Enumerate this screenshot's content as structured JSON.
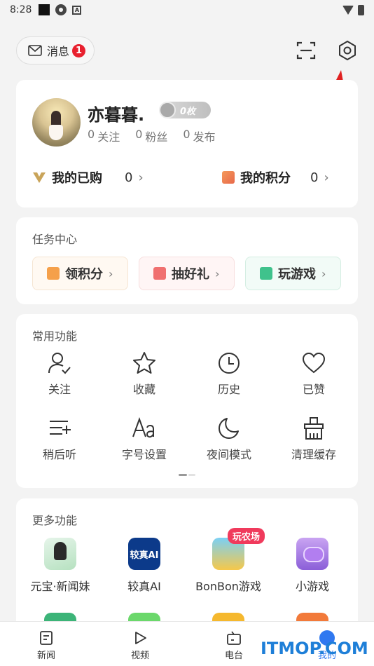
{
  "status_bar": {
    "time": "8:28",
    "a_icon_letter": "A"
  },
  "header": {
    "messages_label": "消息",
    "messages_count": "1"
  },
  "profile": {
    "username": "亦暮暮.",
    "medal_label": "0枚",
    "stats": [
      {
        "num": "0",
        "label": "关注"
      },
      {
        "num": "0",
        "label": "粉丝"
      },
      {
        "num": "0",
        "label": "发布"
      }
    ],
    "purchased_label": "我的已购",
    "purchased_value": "0",
    "points_label": "我的积分",
    "points_value": "0"
  },
  "tasks": {
    "title": "任务中心",
    "items": [
      {
        "label": "领积分"
      },
      {
        "label": "抽好礼"
      },
      {
        "label": "玩游戏"
      }
    ]
  },
  "common": {
    "title": "常用功能",
    "items": [
      {
        "label": "关注",
        "icon": "person-check-icon"
      },
      {
        "label": "收藏",
        "icon": "star-icon"
      },
      {
        "label": "历史",
        "icon": "clock-icon"
      },
      {
        "label": "已赞",
        "icon": "heart-icon"
      },
      {
        "label": "稍后听",
        "icon": "listen-later-icon"
      },
      {
        "label": "字号设置",
        "icon": "font-size-icon"
      },
      {
        "label": "夜间模式",
        "icon": "moon-icon"
      },
      {
        "label": "清理缓存",
        "icon": "broom-icon"
      }
    ]
  },
  "more": {
    "title": "更多功能",
    "apps": [
      {
        "label": "元宝·新闻妹"
      },
      {
        "label": "较真AI",
        "icon_text": "较真AI"
      },
      {
        "label": "BonBon游戏",
        "tag": "玩农场"
      },
      {
        "label": "小游戏"
      }
    ]
  },
  "bottom_nav": [
    {
      "label": "新闻"
    },
    {
      "label": "视频"
    },
    {
      "label": "电台"
    },
    {
      "label": "我的"
    }
  ],
  "watermark": "ITMOP.COM"
}
